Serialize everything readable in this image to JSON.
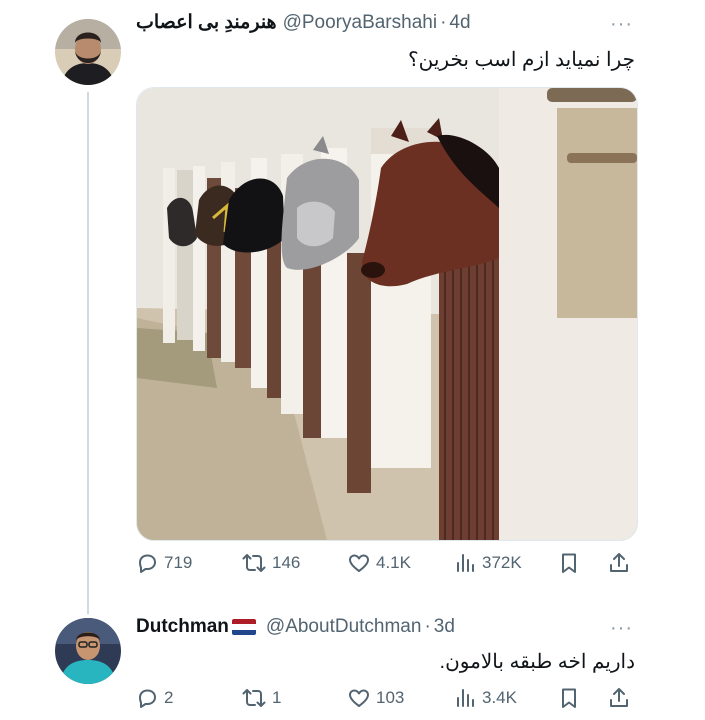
{
  "tweet": {
    "author_name": "هنرمندِ بی اعصاب",
    "handle": "@PooryaBarshahi",
    "separator": "·",
    "time": "4d",
    "more": "···",
    "text": "چرا نمیاید ازم اسب بخرین؟",
    "stats": {
      "replies": "719",
      "retweets": "146",
      "likes": "4.1K",
      "views": "372K"
    }
  },
  "reply": {
    "author_name": "Dutchman",
    "handle": "@AboutDutchman",
    "separator": "·",
    "time": "3d",
    "more": "···",
    "text": "داریم اخه طبقه بالامون.",
    "stats": {
      "replies": "2",
      "retweets": "1",
      "likes": "103",
      "views": "3.4K"
    }
  },
  "icons": {
    "reply": "comment-icon",
    "retweet": "retweet-icon",
    "like": "heart-icon",
    "views": "analytics-icon",
    "bookmark": "bookmark-icon",
    "share": "share-icon"
  },
  "colors": {
    "text": "#0f1419",
    "muted": "#536471",
    "thread_line": "#cfd9de"
  }
}
